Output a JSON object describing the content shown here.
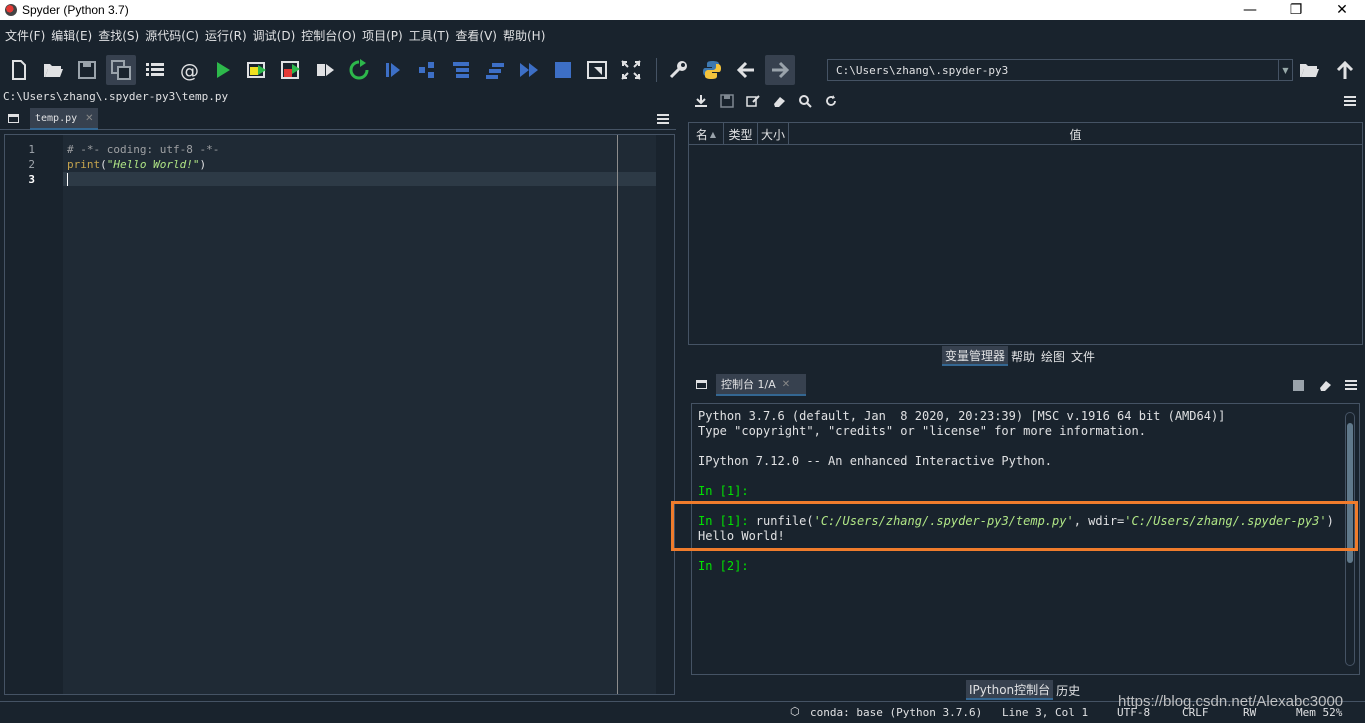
{
  "window": {
    "title": "Spyder (Python 3.7)"
  },
  "menubar": [
    "文件(F)",
    "编辑(E)",
    "查找(S)",
    "源代码(C)",
    "运行(R)",
    "调试(D)",
    "控制台(O)",
    "项目(P)",
    "工具(T)",
    "查看(V)",
    "帮助(H)"
  ],
  "toolbar": {
    "working_dir": "C:\\Users\\zhang\\.spyder-py3"
  },
  "editor": {
    "file_path": "C:\\Users\\zhang\\.spyder-py3\\temp.py",
    "tab_label": "temp.py",
    "line_numbers": [
      "1",
      "2",
      "3"
    ],
    "line1": "# -*- coding: utf-8 -*-",
    "line2_func": "print",
    "line2_open": "(",
    "line2_str": "\"Hello World!\"",
    "line2_close": ")"
  },
  "variable_explorer": {
    "columns": [
      "名",
      "类型",
      "大小",
      "值"
    ],
    "tabs": [
      "变量管理器",
      "帮助",
      "绘图",
      "文件"
    ]
  },
  "console": {
    "tab_label": "控制台 1/A",
    "banner1": "Python 3.7.6 (default, Jan  8 2020, 20:23:39) [MSC v.1916 64 bit (AMD64)]",
    "banner2": "Type \"copyright\", \"credits\" or \"license\" for more information.",
    "banner3": "IPython 7.12.0 -- An enhanced Interactive Python.",
    "prompt1": "In [1]:",
    "prompt1b": "In [1]:",
    "cmd_func": " runfile(",
    "cmd_arg1": "'C:/Users/zhang/.spyder-py3/temp.py'",
    "cmd_mid": ", wdir=",
    "cmd_arg2": "'C:/Users/zhang/.spyder-py3'",
    "cmd_close": ")",
    "output": "Hello World!",
    "prompt2": "In [2]:",
    "tabs": [
      "IPython控制台",
      "历史"
    ]
  },
  "statusbar": {
    "conda": "conda: base (Python 3.7.6)",
    "position": "Line 3, Col 1",
    "encoding": "UTF-8",
    "eol": "CRLF",
    "perm": "RW",
    "mem": "Mem 52%"
  },
  "watermark": "https://blog.csdn.net/Alexabc3000"
}
